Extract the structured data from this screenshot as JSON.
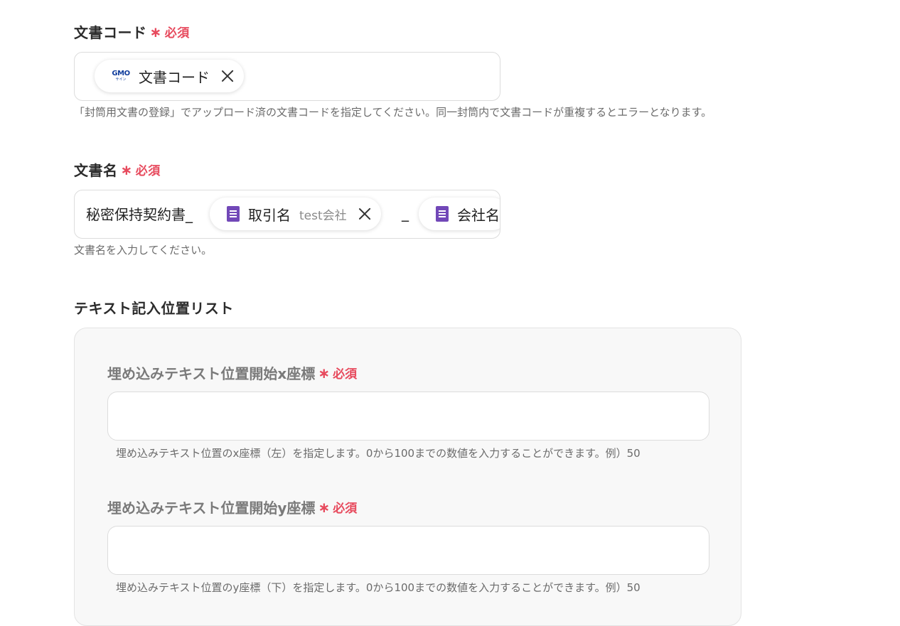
{
  "required_label": "必須",
  "document_code": {
    "label": "文書コード",
    "chip": {
      "icon": "gmo-sign-icon",
      "icon_text": "GMO",
      "icon_subtext": "サイン",
      "label": "文書コード"
    },
    "hint": "「封筒用文書の登録」でアップロード済の文書コードを指定してください。同一封筒内で文書コードが重複するとエラーとなります。"
  },
  "document_name": {
    "label": "文書名",
    "prefix_text": "秘密保持契約書_",
    "chips": [
      {
        "icon": "google-sheets-icon",
        "label": "取引名",
        "sub": "test会社"
      },
      {
        "icon": "google-sheets-icon",
        "label": "会社名",
        "sub": ""
      }
    ],
    "separator_text": "_",
    "hint": "文書名を入力してください。"
  },
  "text_position_list": {
    "label": "テキスト記入位置リスト",
    "x_field": {
      "label": "埋め込みテキスト位置開始x座標",
      "value": "",
      "hint": "埋め込みテキスト位置のx座標（左）を指定します。0から100までの数値を入力することができます。例）50"
    },
    "y_field": {
      "label": "埋め込みテキスト位置開始y座標",
      "value": "",
      "hint": "埋め込みテキスト位置のy座標（下）を指定します。0から100までの数値を入力することができます。例）50"
    }
  },
  "colors": {
    "required": "#e74a5d",
    "sheets_icon": "#7248b8",
    "gmo_brand": "#0f3c9c"
  }
}
